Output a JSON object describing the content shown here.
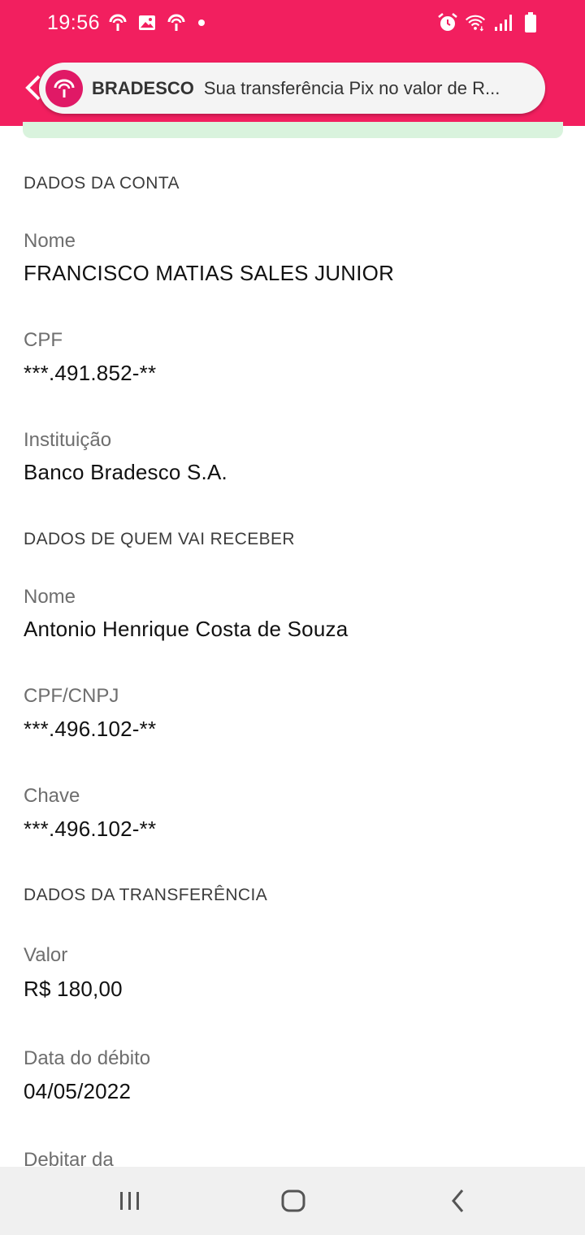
{
  "status_bar": {
    "time": "19:56",
    "left_icons": [
      "bradesco-notification-icon",
      "image-icon",
      "bradesco-notification-icon"
    ],
    "right_icons": [
      "alarm-icon",
      "wifi-icon",
      "signal-icon",
      "battery-icon"
    ],
    "bg_color": "#f21f5f"
  },
  "notification": {
    "app_name": "BRADESCO",
    "text": "Sua transferência Pix no valor de R...",
    "logo_color": "#e01966"
  },
  "sections": {
    "conta": {
      "title": "DADOS DA CONTA",
      "nome_label": "Nome",
      "nome_value": "FRANCISCO MATIAS SALES JUNIOR",
      "cpf_label": "CPF",
      "cpf_value": "***.491.852-**",
      "instituicao_label": "Instituição",
      "instituicao_value": "Banco Bradesco S.A."
    },
    "recebedor": {
      "title": "DADOS DE QUEM VAI RECEBER",
      "nome_label": "Nome",
      "nome_value": "Antonio Henrique Costa de Souza",
      "cpf_cnpj_label": "CPF/CNPJ",
      "cpf_cnpj_value": "***.496.102-**",
      "chave_label": "Chave",
      "chave_value": "***.496.102-**"
    },
    "transferencia": {
      "title": "DADOS DA TRANSFERÊNCIA",
      "valor_label": "Valor",
      "valor_value": "R$ 180,00",
      "data_label": "Data do débito",
      "data_value": "04/05/2022",
      "debitar_label": "Debitar da"
    }
  },
  "nav_bar": {
    "buttons": [
      "recent-apps-icon",
      "home-icon",
      "back-icon"
    ]
  }
}
